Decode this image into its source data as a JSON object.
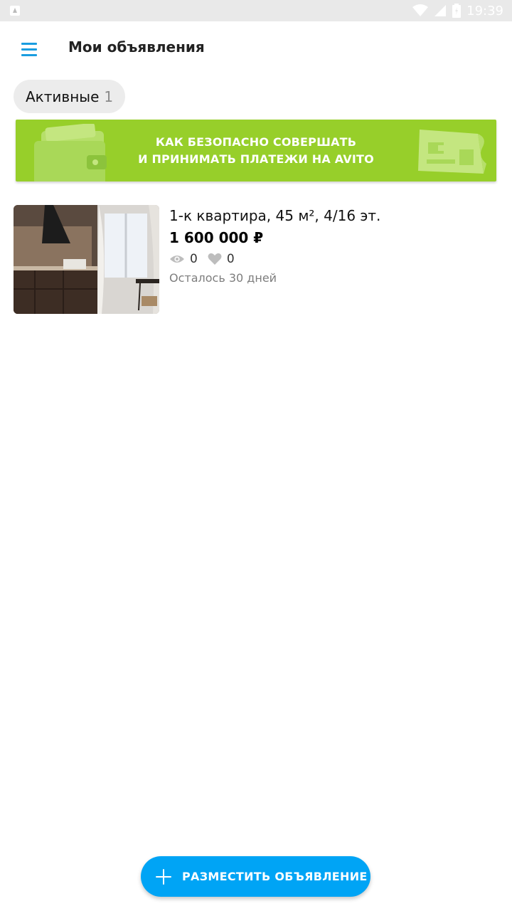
{
  "status_bar": {
    "time": "19:39",
    "icons": [
      "notification-icon",
      "wifi-icon",
      "signal-icon",
      "battery-icon"
    ]
  },
  "header": {
    "title": "Мои объявления",
    "menu_icon": "menu-icon"
  },
  "tabs": [
    {
      "label": "Активные",
      "count": "1"
    }
  ],
  "banner": {
    "line1": "КАК БЕЗОПАСНО СОВЕРШАТЬ",
    "line2": "И ПРИНИМАТЬ ПЛАТЕЖИ НА AVITO",
    "color": "#97cf2a"
  },
  "listings": [
    {
      "title": "1-к квартира, 45 м², 4/16 эт.",
      "price": "1 600 000 ₽",
      "views": "0",
      "favorites": "0",
      "remaining": "Осталось 30 дней"
    }
  ],
  "fab": {
    "label": "РАЗМЕСТИТЬ ОБЪЯВЛЕНИЕ",
    "color": "#00a4f5"
  }
}
